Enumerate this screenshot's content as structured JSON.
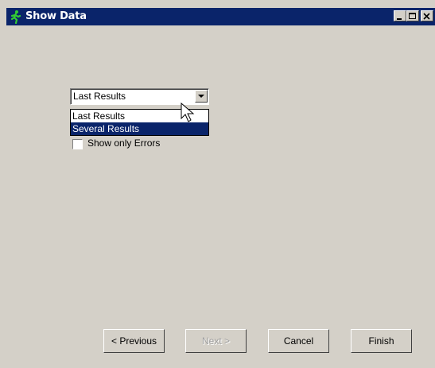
{
  "window": {
    "title": "Show Data",
    "icon": "running-man-icon",
    "controls": [
      "minimize",
      "maximize",
      "close"
    ]
  },
  "combo": {
    "selected": "Last Results",
    "options": [
      "Last Results",
      "Several Results"
    ],
    "highlighted_index": 1
  },
  "checkbox": {
    "label": "Show only Errors",
    "checked": false
  },
  "buttons": {
    "previous": "< Previous",
    "next": "Next >",
    "cancel": "Cancel",
    "finish": "Finish"
  },
  "colors": {
    "titlebar": "#0a246a",
    "face": "#d4d0c8",
    "highlight": "#0a246a"
  }
}
